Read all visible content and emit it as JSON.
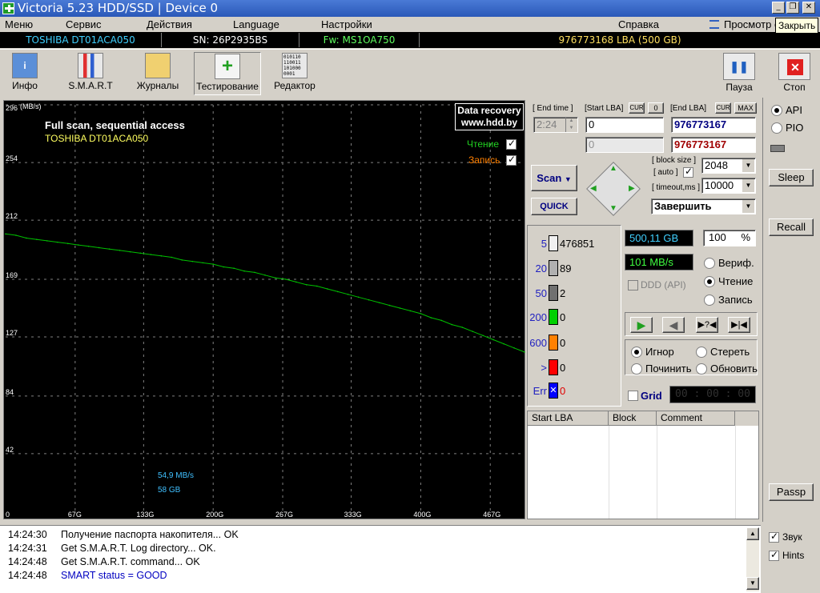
{
  "window": {
    "title": "Victoria 5.23 HDD/SSD  |  Device 0",
    "close_tooltip": "Закрыть"
  },
  "menu": [
    "Меню",
    "Сервис",
    "Действия",
    "Language",
    "Настройки",
    "Справка",
    "Просмотр с"
  ],
  "drive_info": {
    "model": "TOSHIBA DT01ACA050",
    "serial": "SN: 26P2935BS",
    "firmware": "Fw: MS1OA750",
    "capacity": "976773168 LBA (500 GB)"
  },
  "toolbar": {
    "info": "Инфо",
    "smart": "S.M.A.R.T",
    "logs": "Журналы",
    "test": "Тестирование",
    "editor": "Редактор",
    "pause": "Пауза",
    "stop": "Стоп"
  },
  "chart": {
    "watermark_line1": "Data recovery",
    "watermark_line2": "www.hdd.by",
    "scan_title": "Full scan, sequential access",
    "device": "TOSHIBA DT01ACA050",
    "read_label": "Чтение",
    "write_label": "Запись",
    "speed_readout": "54,9 MB/s",
    "position_readout": "58 GB"
  },
  "chart_data": {
    "type": "line",
    "ylabel": "(MB/s)",
    "y_ticks": [
      "296",
      "254",
      "212",
      "169",
      "127",
      "84",
      "42"
    ],
    "x_ticks": [
      "0",
      "67G",
      "133G",
      "200G",
      "267G",
      "333G",
      "400G",
      "467G"
    ],
    "ylim": [
      0,
      296
    ],
    "xlim": [
      0,
      500
    ],
    "series": [
      {
        "name": "Чтение",
        "color": "#00c000",
        "x": [
          0,
          10,
          20,
          30,
          40,
          50,
          60,
          70,
          80,
          90,
          100,
          110,
          120,
          130,
          140,
          150,
          160,
          170,
          180,
          190,
          200,
          210,
          220,
          230,
          240,
          250,
          260,
          270,
          280,
          290,
          300,
          310,
          320,
          330,
          340,
          350,
          360,
          370,
          380,
          390,
          400,
          410,
          420,
          430,
          440,
          450,
          460,
          470,
          480,
          490,
          500
        ],
        "y": [
          202,
          201,
          199,
          198,
          197,
          196,
          195,
          194,
          193,
          192,
          191,
          190,
          189,
          188,
          187,
          186,
          185,
          183,
          182,
          181,
          180,
          178,
          177,
          175,
          174,
          172,
          170,
          169,
          167,
          165,
          164,
          162,
          160,
          158,
          156,
          154,
          152,
          150,
          148,
          146,
          144,
          141,
          139,
          136,
          134,
          131,
          128,
          125,
          122,
          119,
          116
        ]
      }
    ]
  },
  "params": {
    "end_time_label": "[ End time ]",
    "end_time": "2:24",
    "start_lba_label": "[Start LBA]",
    "cur": "CUR",
    "zero": "0",
    "end_lba_label": "[End LBA]",
    "max": "MAX",
    "start_lba": "0",
    "start_lba2": "0",
    "end_lba": "976773167",
    "end_lba2": "976773167",
    "block_size_label": "[ block size ]",
    "auto_label": "[ auto ]",
    "block_size": "2048",
    "timeout_label": "[ timeout,ms ]",
    "timeout": "10000",
    "scan_button": "Scan",
    "quick_button": "QUICK",
    "finish_action": "Завершить"
  },
  "stats": {
    "histogram": [
      {
        "label": "5",
        "value": "476851",
        "color": "#f0f0f0"
      },
      {
        "label": "20",
        "value": "89",
        "color": "#b0b0b0"
      },
      {
        "label": "50",
        "value": "2",
        "color": "#707070"
      },
      {
        "label": "200",
        "value": "0",
        "color": "#00d000"
      },
      {
        "label": "600",
        "value": "0",
        "color": "#ff8000"
      },
      {
        "label": ">",
        "value": "0",
        "color": "#ff0000"
      },
      {
        "label": "Err",
        "value": "0",
        "color": "#0000ff"
      }
    ],
    "scanned": "500,11 GB",
    "percent": "100",
    "percent_sign": "%",
    "speed": "101 MB/s",
    "ddd": "DDD (API)",
    "mode_verify": "Вериф.",
    "mode_read": "Чтение",
    "mode_write": "Запись",
    "act_ignore": "Игнор",
    "act_erase": "Стереть",
    "act_repair": "Починить",
    "act_refresh": "Обновить",
    "grid_label": "Grid",
    "timer": "00 : 00 : 00"
  },
  "table": {
    "columns": [
      "Start LBA",
      "Block",
      "Comment"
    ]
  },
  "side": {
    "api": "API",
    "pio": "PIO",
    "sleep": "Sleep",
    "recall": "Recall",
    "passp": "Passp",
    "sound": "Звук",
    "hints": "Hints"
  },
  "log": [
    {
      "time": "14:24:30",
      "text": "Получение паспорта накопителя... OK",
      "color": "#000000"
    },
    {
      "time": "14:24:31",
      "text": "Get S.M.A.R.T. Log directory... OK.",
      "color": "#000000"
    },
    {
      "time": "14:24:48",
      "text": "Get S.M.A.R.T. command... OK",
      "color": "#000000"
    },
    {
      "time": "14:24:48",
      "text": "SMART status = GOOD",
      "color": "#0000c0"
    }
  ]
}
